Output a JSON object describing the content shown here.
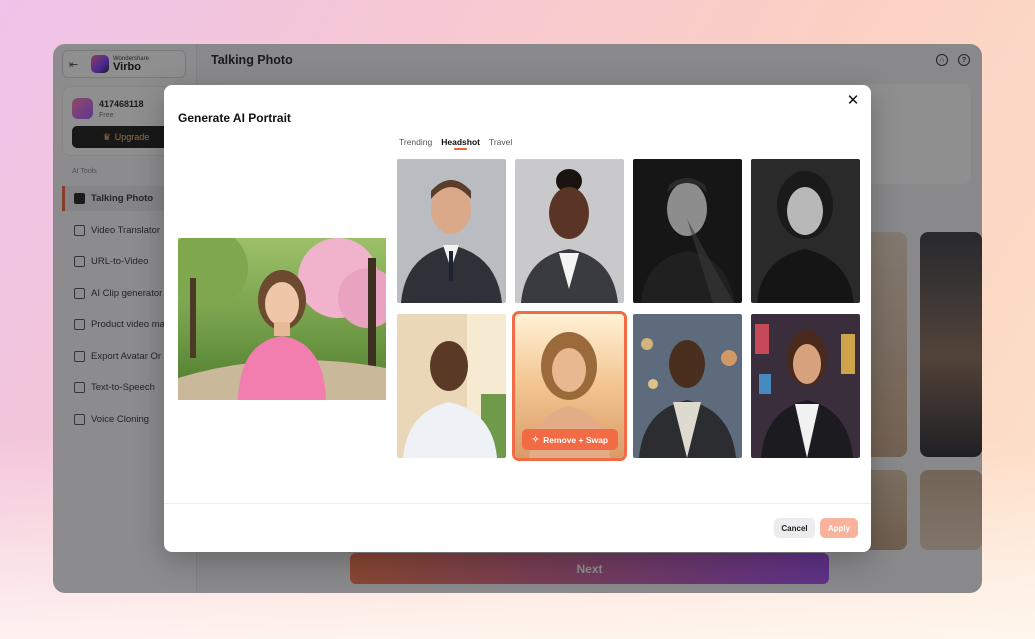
{
  "app": {
    "brand_small": "Wondershare",
    "brand_name": "Virbo",
    "page_title": "Talking Photo",
    "account": {
      "uid": "417468118",
      "plan": "Free",
      "upgrade_label": "Upgrade"
    },
    "section_label": "AI Tools",
    "nav": [
      {
        "label": "Talking Photo",
        "icon": "talking-photo-icon",
        "active": true
      },
      {
        "label": "Video Translator",
        "icon": "video-translator-icon"
      },
      {
        "label": "URL-to-Video",
        "icon": "url-icon"
      },
      {
        "label": "AI Clip generator",
        "icon": "clip-icon"
      },
      {
        "label": "Product video ma",
        "icon": "product-icon"
      },
      {
        "label": "Export Avatar Or",
        "icon": "avatar-icon"
      },
      {
        "label": "Text-to-Speech",
        "icon": "speech-icon"
      },
      {
        "label": "Voice Cloning",
        "icon": "voice-icon"
      }
    ],
    "next_label": "Next",
    "header_icons": [
      "headset-icon",
      "help-icon"
    ]
  },
  "modal": {
    "title": "Generate AI Portrait",
    "tabs": [
      {
        "label": "Trending",
        "active": false
      },
      {
        "label": "Headshot",
        "active": true
      },
      {
        "label": "Travel",
        "active": false
      }
    ],
    "portraits": [
      {
        "name": "portrait-businessman",
        "selected": false
      },
      {
        "name": "portrait-businesswoman",
        "selected": false
      },
      {
        "name": "portrait-bw-man",
        "selected": false
      },
      {
        "name": "portrait-bw-woman",
        "selected": false
      },
      {
        "name": "portrait-white-shirt-man",
        "selected": false
      },
      {
        "name": "portrait-beach-woman",
        "selected": true
      },
      {
        "name": "portrait-city-man",
        "selected": false
      },
      {
        "name": "portrait-neon-woman",
        "selected": false
      }
    ],
    "swap_label": "Remove + Swap",
    "cancel_label": "Cancel",
    "apply_label": "Apply"
  },
  "colors": {
    "accent": "#f26b45",
    "apply_disabled": "#f9b29b",
    "next_gradient_start": "#f2744a",
    "next_gradient_end": "#a24cf0"
  }
}
